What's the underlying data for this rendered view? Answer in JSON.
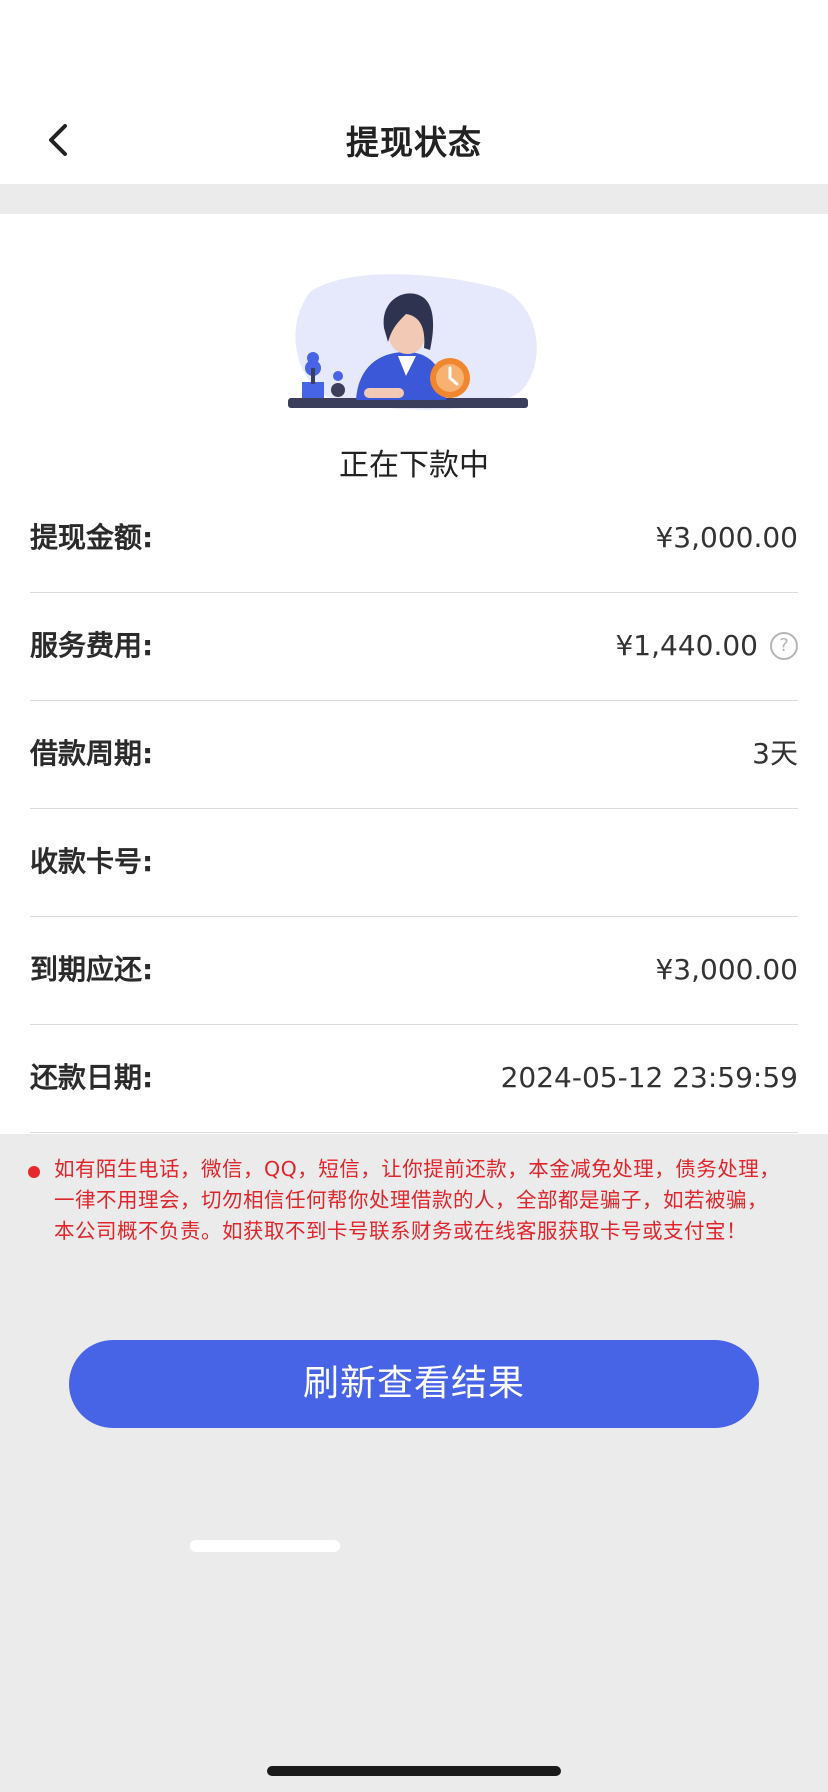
{
  "header": {
    "title": "提现状态"
  },
  "status": {
    "text": "正在下款中"
  },
  "details": [
    {
      "label": "提现金额:",
      "value": "¥3,000.00"
    },
    {
      "label": "服务费用:",
      "value": "¥1,440.00"
    },
    {
      "label": "借款周期:",
      "value": "3天"
    },
    {
      "label": "收款卡号:",
      "value": ""
    },
    {
      "label": "到期应还:",
      "value": "¥3,000.00"
    },
    {
      "label": "还款日期:",
      "value": "2024-05-12 23:59:59"
    }
  ],
  "notice": {
    "text": "如有陌生电话，微信，QQ，短信，让你提前还款，本金减免处理，债务处理，一律不用理会，切勿相信任何帮你处理借款的人，全部都是骗子，如若被骗，本公司概不负责。如获取不到卡号联系财务或在线客服获取卡号或支付宝！"
  },
  "actions": {
    "refresh_label": "刷新查看结果"
  },
  "icons": {
    "back": "chevron-left-icon",
    "help": "question-circle-icon",
    "illustration": "woman-waiting-clock-illustration"
  },
  "colors": {
    "primary": "#4763e6",
    "warning": "#e0262c",
    "accent_orange": "#f0862e"
  }
}
